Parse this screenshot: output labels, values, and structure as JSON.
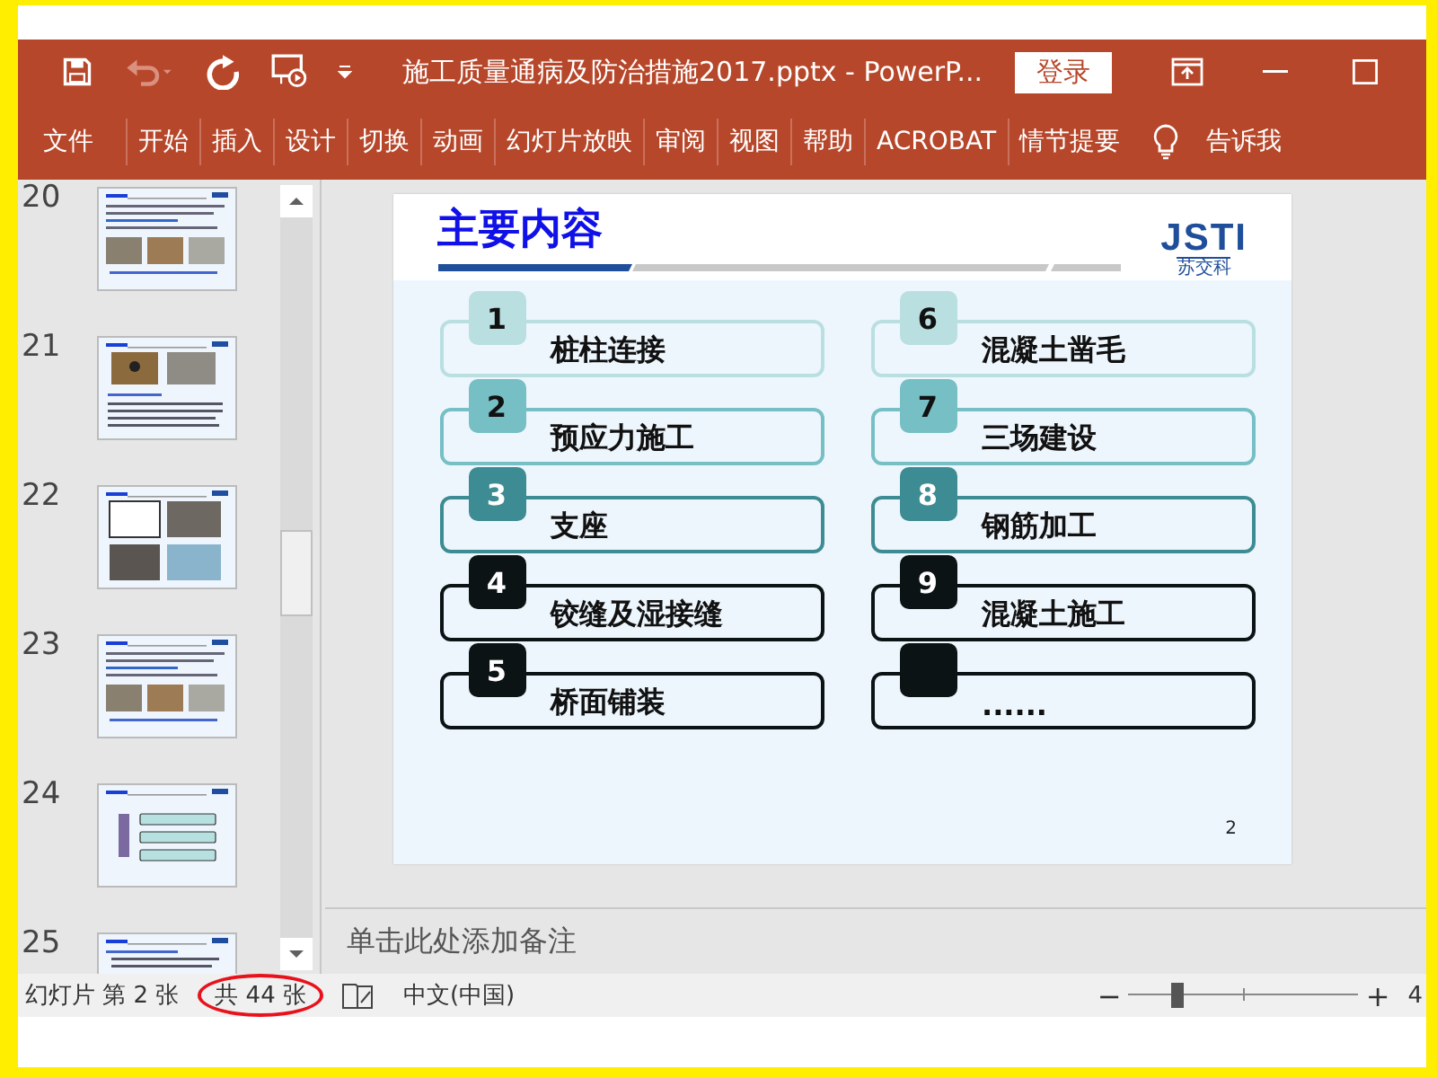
{
  "window": {
    "title": "施工质量通病及防治措施2017.pptx  -  PowerP...",
    "signin": "登录",
    "quick_access": [
      {
        "kind": "save",
        "disabled": false
      },
      {
        "kind": "undo",
        "disabled": true
      },
      {
        "kind": "redo",
        "disabled": false
      },
      {
        "kind": "present",
        "disabled": false
      },
      {
        "kind": "customize",
        "disabled": false
      }
    ]
  },
  "ribbon_tabs": [
    {
      "label": "文件",
      "selected": false
    },
    {
      "label": "开始",
      "selected": false
    },
    {
      "label": "插入",
      "selected": false
    },
    {
      "label": "设计",
      "selected": false
    },
    {
      "label": "切换",
      "selected": false
    },
    {
      "label": "动画",
      "selected": false
    },
    {
      "label": "幻灯片放映",
      "selected": false
    },
    {
      "label": "审阅",
      "selected": false
    },
    {
      "label": "视图",
      "selected": false
    },
    {
      "label": "帮助",
      "selected": false
    },
    {
      "label": "ACROBAT",
      "selected": false
    },
    {
      "label": "情节提要",
      "selected": false
    }
  ],
  "tell_me": "告诉我",
  "thumbnails": [
    {
      "number": "20",
      "kind": "text-photos"
    },
    {
      "number": "21",
      "kind": "photos-text"
    },
    {
      "number": "22",
      "kind": "photo-grid"
    },
    {
      "number": "23",
      "kind": "text-photos"
    },
    {
      "number": "24",
      "kind": "outline"
    },
    {
      "number": "25",
      "kind": "text"
    }
  ],
  "slide": {
    "title": "主要内容",
    "logo": "JSTI",
    "logo_caption": "苏交科",
    "page_number": "2",
    "items": [
      {
        "number": "1",
        "label": "桩柱连接",
        "color": "#b9dfe1"
      },
      {
        "number": "2",
        "label": "预应力施工",
        "color": "#76bfc5"
      },
      {
        "number": "3",
        "label": "支座",
        "color": "#3e8c93"
      },
      {
        "number": "4",
        "label": "铰缝及湿接缝",
        "color": "#0b1315"
      },
      {
        "number": "5",
        "label": "桥面铺装",
        "color": "#0b1315"
      },
      {
        "number": "6",
        "label": "混凝土凿毛",
        "color": "#b9dfe1"
      },
      {
        "number": "7",
        "label": "三场建设",
        "color": "#76bfc5"
      },
      {
        "number": "8",
        "label": "钢筋加工",
        "color": "#3e8c93"
      },
      {
        "number": "9",
        "label": "混凝土施工",
        "color": "#0b1315"
      },
      {
        "label": "......",
        "color": "#0b1315"
      }
    ]
  },
  "notes": {
    "placeholder": "单击此处添加备注"
  },
  "status_bar": {
    "slide": "幻灯片 第 2 张",
    "slide_total": "共 44 张",
    "slide_total_circled": true,
    "language": "中文(中国)",
    "zoom_out": "−",
    "zoom_in": "+",
    "zoom": {
      "level": 0.22
    },
    "zoom_value": "4"
  }
}
